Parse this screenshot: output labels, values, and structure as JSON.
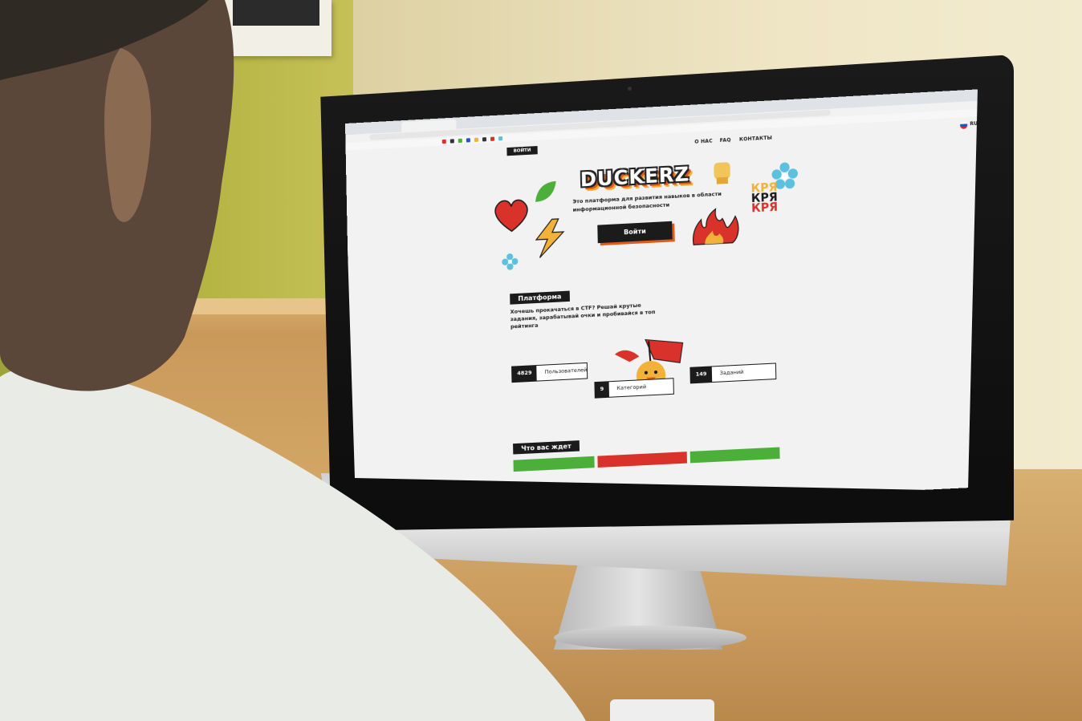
{
  "site": {
    "nav": {
      "about": "О НАС",
      "faq": "FAQ",
      "contacts": "КОНТАКТЫ",
      "lang": "RU",
      "login": "ВОЙТИ"
    },
    "hero": {
      "logo": "DUCKERZ",
      "tagline": "Это платформа для развития навыков в области информационной безопасности",
      "cta": "Войти",
      "sticker_text": [
        "КРЯ",
        "КРЯ",
        "КРЯ"
      ]
    },
    "platform": {
      "label": "Платформа",
      "description": "Хочешь прокачаться в CTF? Решай крутые задания, зарабатывай очки и пробивайся в топ рейтинга"
    },
    "stats": [
      {
        "value": "4829",
        "label": "Пользователей"
      },
      {
        "value": "9",
        "label": "Категорий"
      },
      {
        "value": "149",
        "label": "Заданий"
      }
    ],
    "expect": {
      "label": "Что вас ждет"
    }
  },
  "colors": {
    "accent_orange": "#e25a1b",
    "accent_red": "#d9322a",
    "accent_yellow": "#f2b23a",
    "accent_green": "#4caf3a",
    "accent_blue": "#5cc0df"
  }
}
